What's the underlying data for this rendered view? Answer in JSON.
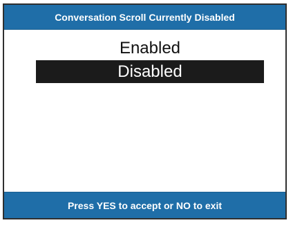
{
  "dialog": {
    "title": "Conversation Scroll Currently Disabled",
    "footer": "Press YES to accept or NO to exit",
    "options": [
      {
        "label": "Enabled",
        "selected": false
      },
      {
        "label": "Disabled",
        "selected": true
      }
    ]
  },
  "colors": {
    "bar_background": "#1f6ea8",
    "bar_text": "#ffffff",
    "selected_background": "#1b1b1b",
    "selected_text": "#ffffff",
    "content_background": "#ffffff",
    "frame_border": "#2f2f2f"
  }
}
